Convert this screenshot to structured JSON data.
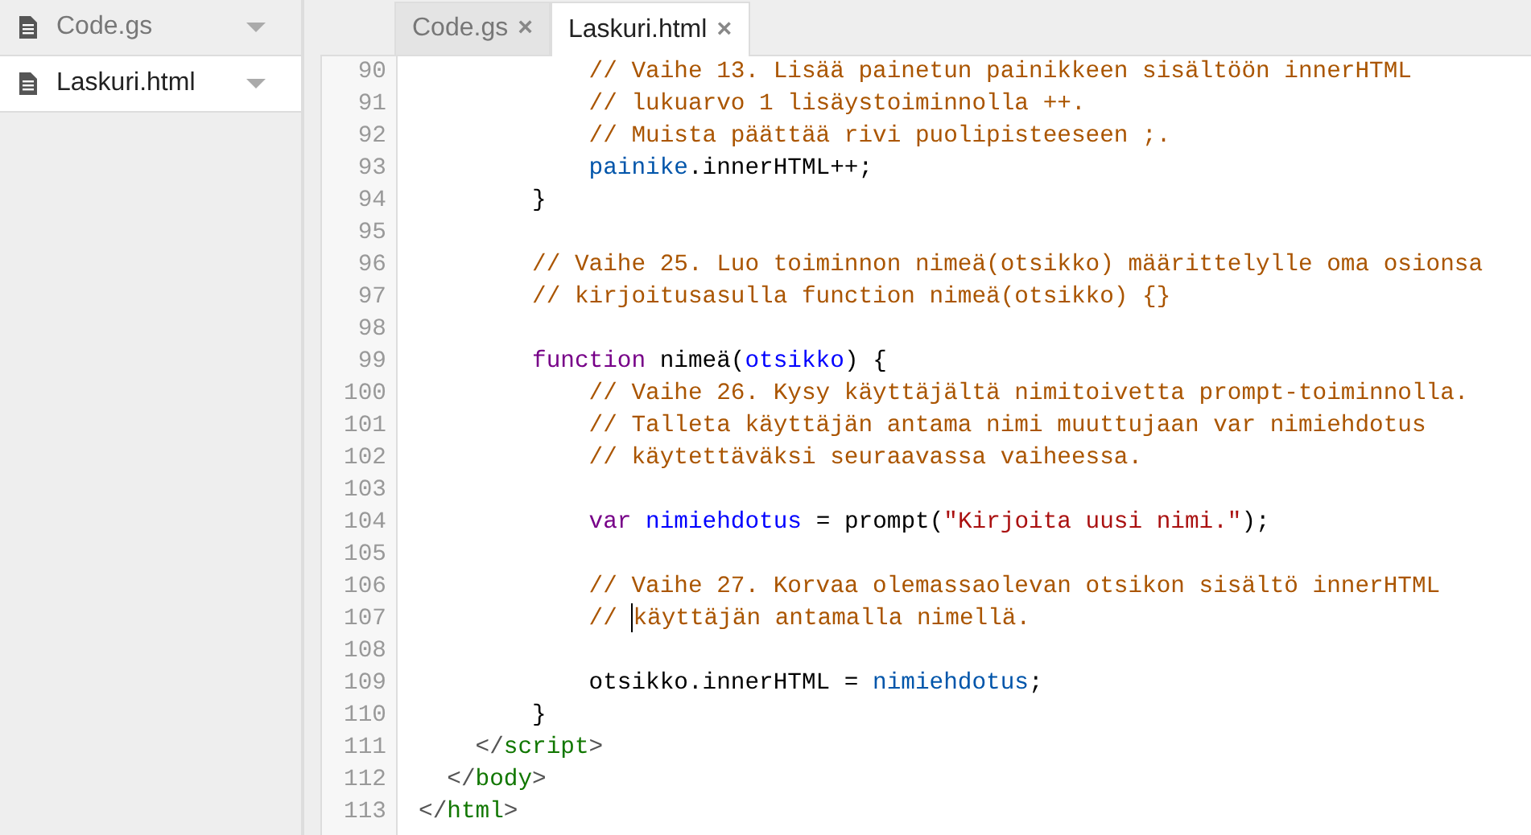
{
  "sidebar": {
    "items": [
      {
        "label": "Code.gs",
        "selected": false
      },
      {
        "label": "Laskuri.html",
        "selected": true
      }
    ]
  },
  "tabs": [
    {
      "label": "Code.gs",
      "close": "×",
      "selected": false
    },
    {
      "label": "Laskuri.html",
      "close": "×",
      "selected": true
    }
  ],
  "editor": {
    "lines": [
      {
        "number": "90",
        "tokens": [
          {
            "kind": "comment",
            "text": "            // Vaihe 13. Lisää painetun painikkeen sisältöön innerHTML"
          }
        ]
      },
      {
        "number": "91",
        "tokens": [
          {
            "kind": "comment",
            "text": "            // lukuarvo 1 lisäystoiminnolla ++."
          }
        ]
      },
      {
        "number": "92",
        "tokens": [
          {
            "kind": "comment",
            "text": "            // Muista päättää rivi puolipisteeseen ;."
          }
        ]
      },
      {
        "number": "93",
        "tokens": [
          {
            "kind": "variable",
            "text": "            painike"
          },
          {
            "kind": "plain",
            "text": ".innerHTML++;"
          }
        ]
      },
      {
        "number": "94",
        "tokens": [
          {
            "kind": "plain",
            "text": "        }"
          }
        ]
      },
      {
        "number": "95"
      },
      {
        "number": "96",
        "tokens": [
          {
            "kind": "comment",
            "text": "        // Vaihe 25. Luo toiminnon nimeä(otsikko) määrittelylle oma osionsa"
          }
        ]
      },
      {
        "number": "97",
        "tokens": [
          {
            "kind": "comment",
            "text": "        // kirjoitusasulla function nimeä(otsikko) {}"
          }
        ]
      },
      {
        "number": "98"
      },
      {
        "number": "99",
        "tokens": [
          {
            "kind": "keyword",
            "text": "        function"
          },
          {
            "kind": "plain",
            "text": " nimeä("
          },
          {
            "kind": "def",
            "text": "otsikko"
          },
          {
            "kind": "plain",
            "text": ") {"
          }
        ]
      },
      {
        "number": "100",
        "tokens": [
          {
            "kind": "comment",
            "text": "            // Vaihe 26. Kysy käyttäjältä nimitoivetta prompt-toiminnolla."
          }
        ]
      },
      {
        "number": "101",
        "tokens": [
          {
            "kind": "comment",
            "text": "            // Talleta käyttäjän antama nimi muuttujaan var nimiehdotus"
          }
        ]
      },
      {
        "number": "102",
        "tokens": [
          {
            "kind": "comment",
            "text": "            // käytettäväksi seuraavassa vaiheessa."
          }
        ]
      },
      {
        "number": "103"
      },
      {
        "number": "104",
        "tokens": [
          {
            "kind": "keyword",
            "text": "            var "
          },
          {
            "kind": "def",
            "text": "nimiehdotus"
          },
          {
            "kind": "plain",
            "text": " = prompt("
          },
          {
            "kind": "string",
            "text": "\"Kirjoita uusi nimi.\""
          },
          {
            "kind": "plain",
            "text": ");"
          }
        ]
      },
      {
        "number": "105"
      },
      {
        "number": "106",
        "tokens": [
          {
            "kind": "comment",
            "text": "            // Vaihe 27. Korvaa olemassaolevan otsikon sisältö innerHTML"
          }
        ]
      },
      {
        "number": "107",
        "tokens": [
          {
            "kind": "comment",
            "text": "            // "
          },
          {
            "kind": "comment",
            "text": "käyttäjän antamalla nimellä.",
            "caret_before": true
          }
        ]
      },
      {
        "number": "108"
      },
      {
        "number": "109",
        "tokens": [
          {
            "kind": "plain",
            "text": "            otsikko.innerHTML = "
          },
          {
            "kind": "variable",
            "text": "nimiehdotus"
          },
          {
            "kind": "plain",
            "text": ";"
          }
        ]
      },
      {
        "number": "110",
        "tokens": [
          {
            "kind": "plain",
            "text": "        }"
          }
        ]
      },
      {
        "number": "111",
        "tokens": [
          {
            "kind": "bracket",
            "text": "    </"
          },
          {
            "kind": "tag",
            "text": "script"
          },
          {
            "kind": "bracket",
            "text": ">"
          }
        ]
      },
      {
        "number": "112",
        "tokens": [
          {
            "kind": "bracket",
            "text": "  </"
          },
          {
            "kind": "tag",
            "text": "body"
          },
          {
            "kind": "bracket",
            "text": ">"
          }
        ]
      },
      {
        "number": "113",
        "tokens": [
          {
            "kind": "bracket",
            "text": "</"
          },
          {
            "kind": "tag",
            "text": "html"
          },
          {
            "kind": "bracket",
            "text": ">"
          }
        ]
      }
    ]
  }
}
